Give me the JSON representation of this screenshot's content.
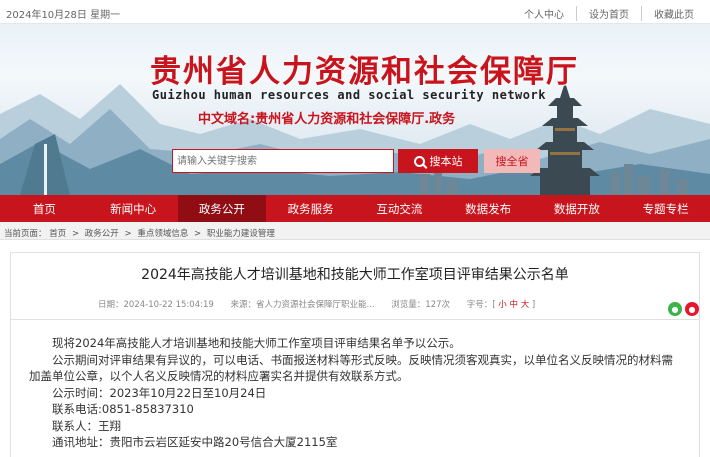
{
  "topbar": {
    "date": "2024年10月28日 星期一",
    "links": [
      "个人中心",
      "设为首页",
      "收藏此页"
    ]
  },
  "banner": {
    "title_zh": "贵州省人力资源和社会保障厅",
    "title_en": "Guizhou human resources and social security network",
    "domain": "中文域名:贵州省人力资源和社会保障厅.政务"
  },
  "search": {
    "placeholder": "请输入关键字搜索",
    "site_button": "搜本站",
    "province_button": "搜全省"
  },
  "nav": {
    "items": [
      "首页",
      "新闻中心",
      "政务公开",
      "政务服务",
      "互动交流",
      "数据发布",
      "数据开放",
      "专题专栏"
    ],
    "active": "政务公开"
  },
  "breadcrumb": {
    "prefix": "当前页面：",
    "items": [
      "首页",
      "政务公开",
      "重点领域信息",
      "职业能力建设管理"
    ],
    "separator": ">"
  },
  "article": {
    "title": "2024年高技能人才培训基地和技能大师工作室项目评审结果公示名单",
    "meta": {
      "date": "日期：2024-10-22 15:04:19",
      "source": "来源：省人力资源社会保障厅职业能...",
      "views": "浏览量：127次",
      "font_label": "字号：",
      "font_small": "小",
      "font_medium": "中",
      "font_large": "大"
    },
    "share": [
      "wechat-icon",
      "weibo-icon"
    ],
    "paragraphs": [
      "现将2024年高技能人才培训基地和技能大师工作室项目评审结果名单予以公示。",
      "公示期间对评审结果有异议的，可以电话、书面报送材料等形式反映。反映情况须客观真实，以单位名义反映情况的材料需加盖单位公章，以个人名义反映情况的材料应署实名并提供有效联系方式。",
      "公示时间：2023年10月22日至10月24日",
      "联系电话:0851-85837310",
      "联系人：王翔",
      "通讯地址：贵阳市云岩区延安中路20号信合大厦2115室"
    ]
  },
  "colors": {
    "brand_red": "#c8141d",
    "nav_active": "#8f0d13"
  }
}
